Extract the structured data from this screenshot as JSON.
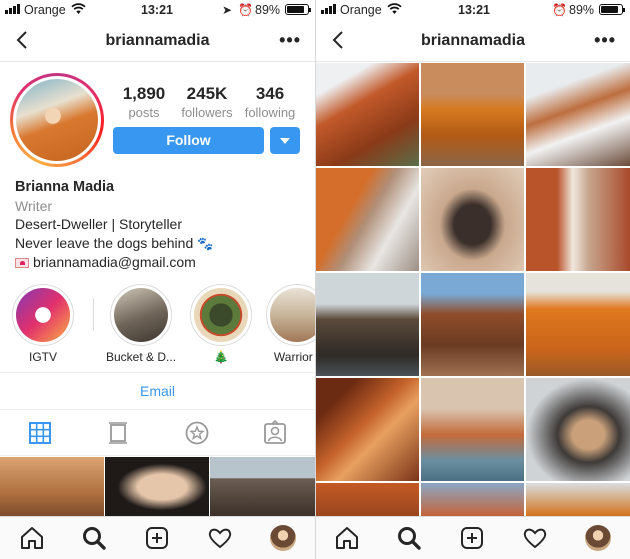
{
  "status_left": {
    "carrier": "Orange",
    "time": "13:21",
    "battery": "89%"
  },
  "status_right": {
    "carrier": "Orange",
    "time": "13:21",
    "battery": "89%"
  },
  "nav_left": {
    "title": "briannamadia"
  },
  "nav_right": {
    "title": "briannamadia"
  },
  "profile": {
    "stats": [
      {
        "value": "1,890",
        "label": "posts"
      },
      {
        "value": "245K",
        "label": "followers"
      },
      {
        "value": "346",
        "label": "following"
      }
    ],
    "follow_label": "Follow",
    "name": "Brianna Madia",
    "category": "Writer",
    "bio_line1": "Desert-Dweller | Storyteller",
    "bio_line2": "Never leave the dogs behind",
    "email": "briannamadia@gmail.com"
  },
  "highlights": [
    {
      "label": "IGTV"
    },
    {
      "label": "Bucket & D..."
    },
    {
      "label": "🎄"
    },
    {
      "label": "Warrior ("
    }
  ],
  "email_button": "Email",
  "icons": {
    "grid": "grid-icon",
    "feed": "feed-icon",
    "saved": "star-circle-icon",
    "tagged": "tagged-icon",
    "home": "home-icon",
    "search": "search-icon",
    "add": "add-post-icon",
    "activity": "heart-icon"
  },
  "colors": {
    "accent": "#3897f0",
    "muted": "#8e8e8e",
    "text": "#262626"
  }
}
